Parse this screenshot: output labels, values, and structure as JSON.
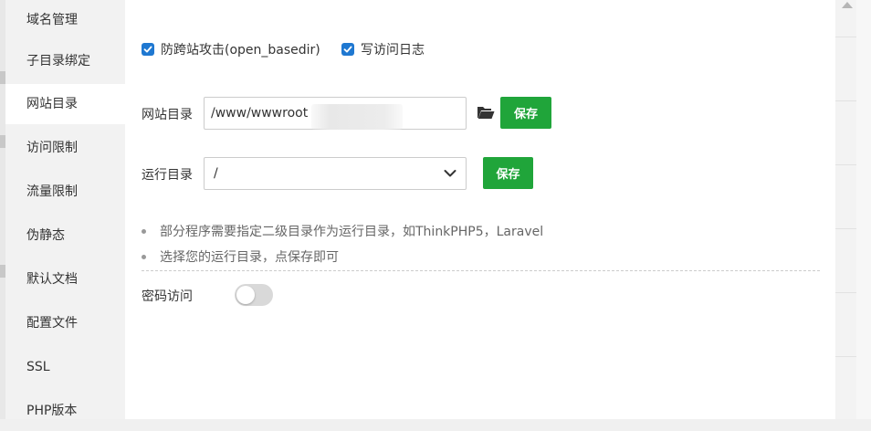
{
  "sidebar": {
    "items": [
      {
        "label": "域名管理"
      },
      {
        "label": "子目录绑定"
      },
      {
        "label": "网站目录",
        "active": true
      },
      {
        "label": "访问限制"
      },
      {
        "label": "流量限制"
      },
      {
        "label": "伪静态"
      },
      {
        "label": "默认文档"
      },
      {
        "label": "配置文件"
      },
      {
        "label": "SSL"
      },
      {
        "label": "PHP版本"
      }
    ]
  },
  "options": {
    "open_basedir_label": "防跨站攻击(open_basedir)",
    "open_basedir_checked": true,
    "access_log_label": "写访问日志",
    "access_log_checked": true
  },
  "site_dir": {
    "label": "网站目录",
    "value": "/www/wwwroot",
    "browse_icon": "folder-open-icon",
    "save_label": "保存"
  },
  "run_dir": {
    "label": "运行目录",
    "selected": "/",
    "save_label": "保存"
  },
  "tips": [
    "部分程序需要指定二级目录作为运行目录，如ThinkPHP5，Laravel",
    "选择您的运行目录，点保存即可"
  ],
  "password_access": {
    "label": "密码访问",
    "enabled": false
  },
  "colors": {
    "accent_green": "#20a53a",
    "checkbox_blue": "#1f78d1",
    "sidebar_bg": "#f2f2f2"
  }
}
